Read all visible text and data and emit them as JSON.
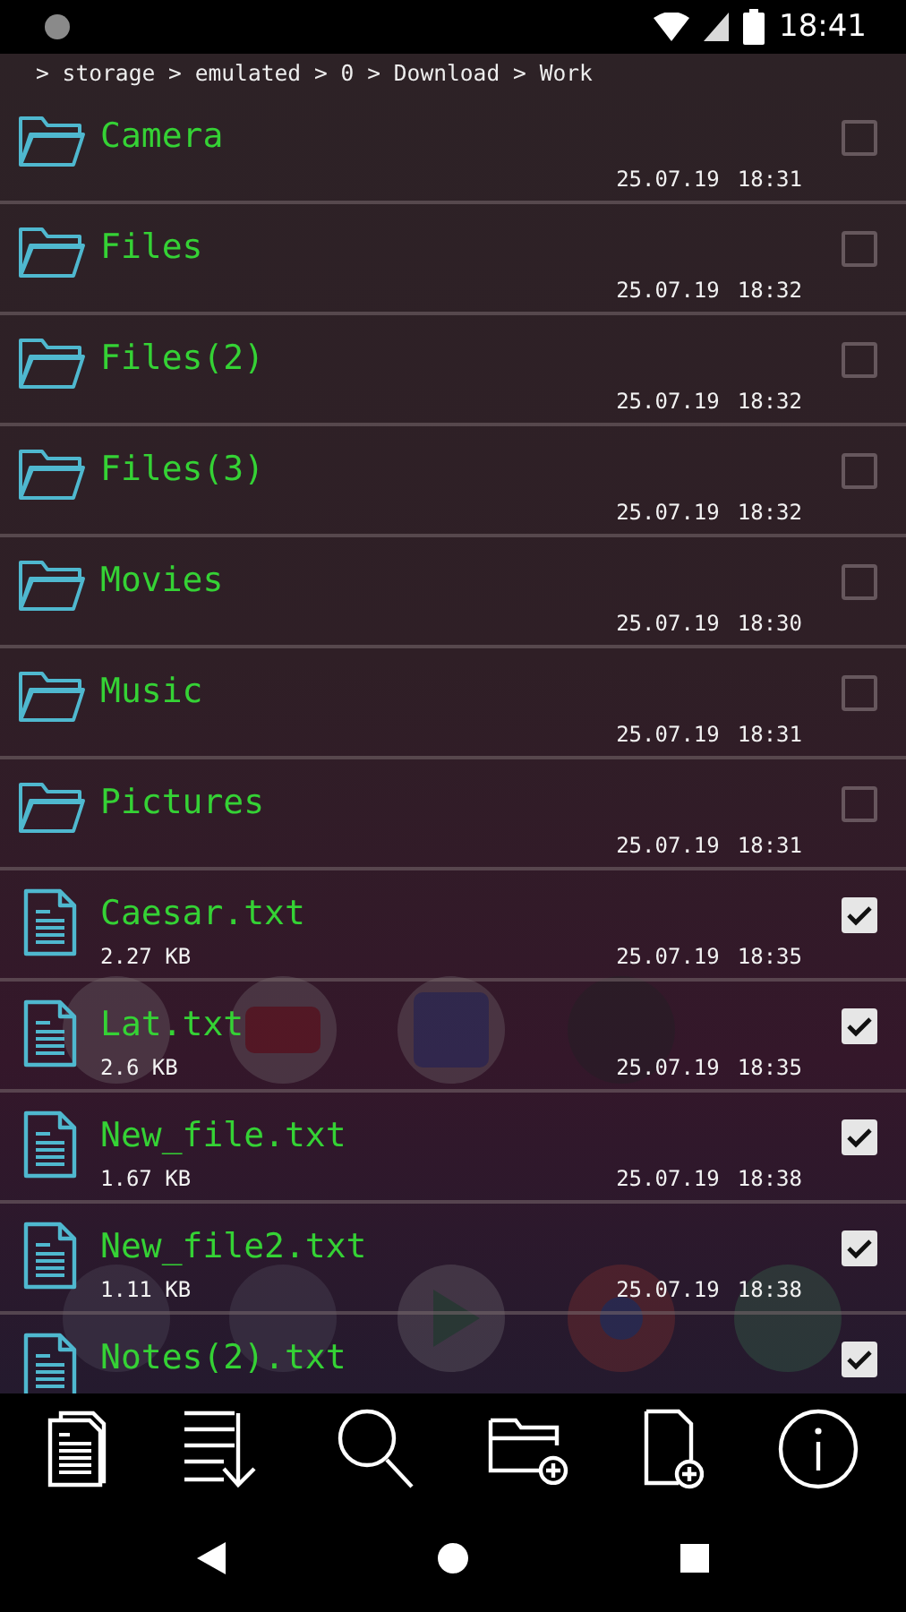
{
  "status_bar": {
    "time": "18:41"
  },
  "breadcrumb": "> storage > emulated > 0 > Download > Work",
  "items": [
    {
      "kind": "folder",
      "name": "Camera",
      "date": "25.07.19",
      "time": "18:31",
      "checked": false
    },
    {
      "kind": "folder",
      "name": "Files",
      "date": "25.07.19",
      "time": "18:32",
      "checked": false
    },
    {
      "kind": "folder",
      "name": "Files(2)",
      "date": "25.07.19",
      "time": "18:32",
      "checked": false
    },
    {
      "kind": "folder",
      "name": "Files(3)",
      "date": "25.07.19",
      "time": "18:32",
      "checked": false
    },
    {
      "kind": "folder",
      "name": "Movies",
      "date": "25.07.19",
      "time": "18:30",
      "checked": false
    },
    {
      "kind": "folder",
      "name": "Music",
      "date": "25.07.19",
      "time": "18:31",
      "checked": false
    },
    {
      "kind": "folder",
      "name": "Pictures",
      "date": "25.07.19",
      "time": "18:31",
      "checked": false
    },
    {
      "kind": "file",
      "name": "Caesar.txt",
      "size": "2.27 KB",
      "date": "25.07.19",
      "time": "18:35",
      "checked": true
    },
    {
      "kind": "file",
      "name": "Lat.txt",
      "size": "2.6 KB",
      "date": "25.07.19",
      "time": "18:35",
      "checked": true
    },
    {
      "kind": "file",
      "name": "New_file.txt",
      "size": "1.67 KB",
      "date": "25.07.19",
      "time": "18:38",
      "checked": true
    },
    {
      "kind": "file",
      "name": "New_file2.txt",
      "size": "1.11 KB",
      "date": "25.07.19",
      "time": "18:38",
      "checked": true
    },
    {
      "kind": "file",
      "name": "Notes(2).txt",
      "checked": true
    }
  ]
}
